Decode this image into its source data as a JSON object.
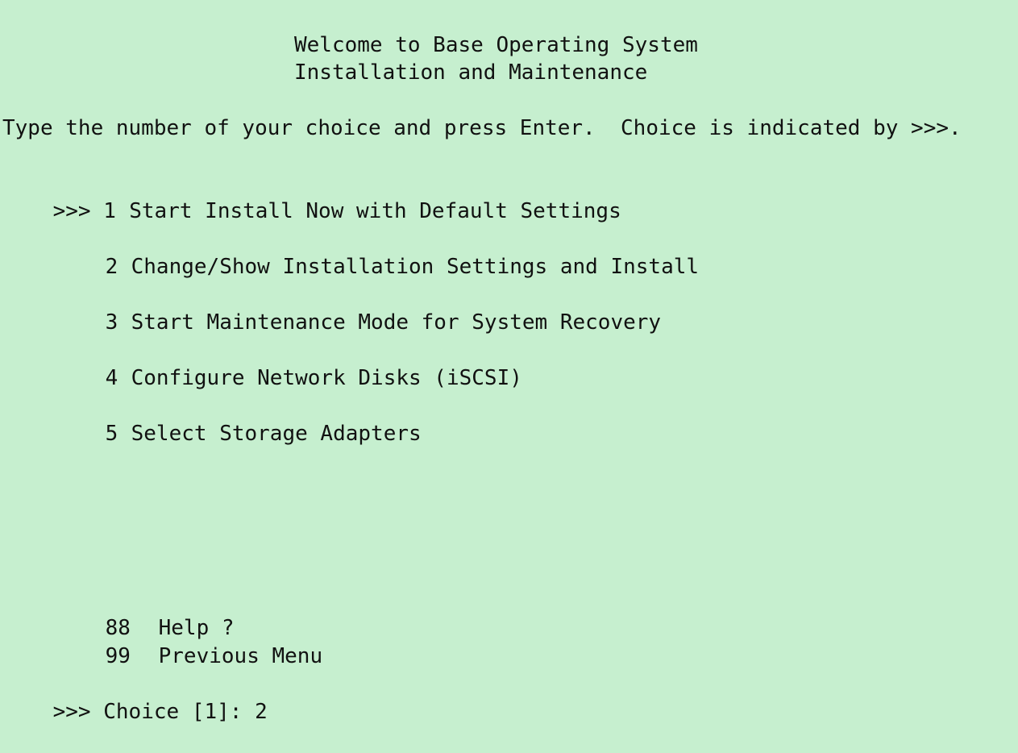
{
  "header": {
    "title": "Welcome to Base Operating System",
    "subtitle": "Installation and Maintenance"
  },
  "instructions": "Type the number of your choice and press Enter.  Choice is indicated by >>>.",
  "menu": {
    "indicator": ">>>",
    "items": [
      {
        "number": "1",
        "label": "Start Install Now with Default Settings",
        "selected": true
      },
      {
        "number": "2",
        "label": "Change/Show Installation Settings and Install",
        "selected": false
      },
      {
        "number": "3",
        "label": "Start Maintenance Mode for System Recovery",
        "selected": false
      },
      {
        "number": "4",
        "label": "Configure Network Disks (iSCSI)",
        "selected": false
      },
      {
        "number": "5",
        "label": "Select Storage Adapters",
        "selected": false
      }
    ],
    "extra_items": [
      {
        "number": "88",
        "label": "Help ?"
      },
      {
        "number": "99",
        "label": "Previous Menu"
      }
    ]
  },
  "prompt": {
    "indicator": ">>>",
    "label": "Choice [1]:",
    "value": "2"
  }
}
